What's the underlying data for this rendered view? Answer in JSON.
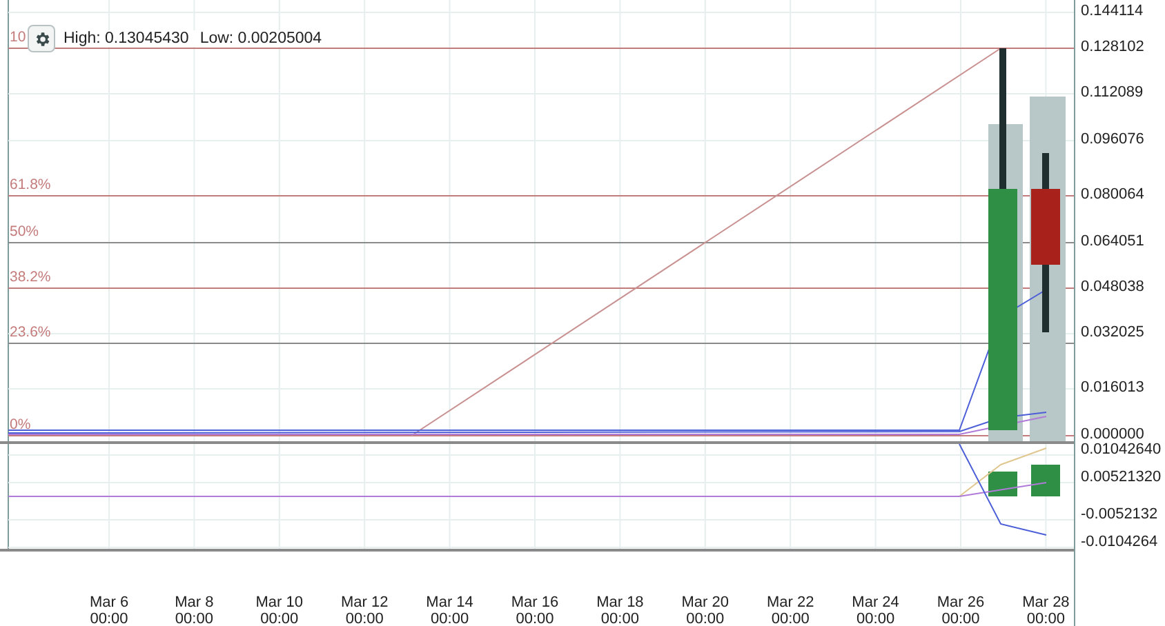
{
  "header": {
    "high": "High: 0.13045430",
    "low": "Low: 0.00205004"
  },
  "fib_levels": [
    {
      "label": "10"
    },
    {
      "label": "61.8%"
    },
    {
      "label": "50%"
    },
    {
      "label": "38.2%"
    },
    {
      "label": "23.6%"
    },
    {
      "label": "0%"
    }
  ],
  "price_axis": [
    "0.144114",
    "0.128102",
    "0.112089",
    "0.096076",
    "0.080064",
    "0.064051",
    "0.048038",
    "0.032025",
    "0.016013",
    "0.000000"
  ],
  "indicator_axis": [
    "0.01042640",
    "0.00521320",
    "-0.0052132",
    "-0.0104264"
  ],
  "date_axis": [
    {
      "date": "Mar 6",
      "time": "00:00"
    },
    {
      "date": "Mar 8",
      "time": "00:00"
    },
    {
      "date": "Mar 10",
      "time": "00:00"
    },
    {
      "date": "Mar 12",
      "time": "00:00"
    },
    {
      "date": "Mar 14",
      "time": "00:00"
    },
    {
      "date": "Mar 16",
      "time": "00:00"
    },
    {
      "date": "Mar 18",
      "time": "00:00"
    },
    {
      "date": "Mar 20",
      "time": "00:00"
    },
    {
      "date": "Mar 22",
      "time": "00:00"
    },
    {
      "date": "Mar 24",
      "time": "00:00"
    },
    {
      "date": "Mar 26",
      "time": "00:00"
    },
    {
      "date": "Mar 28",
      "time": "00:00"
    }
  ]
}
